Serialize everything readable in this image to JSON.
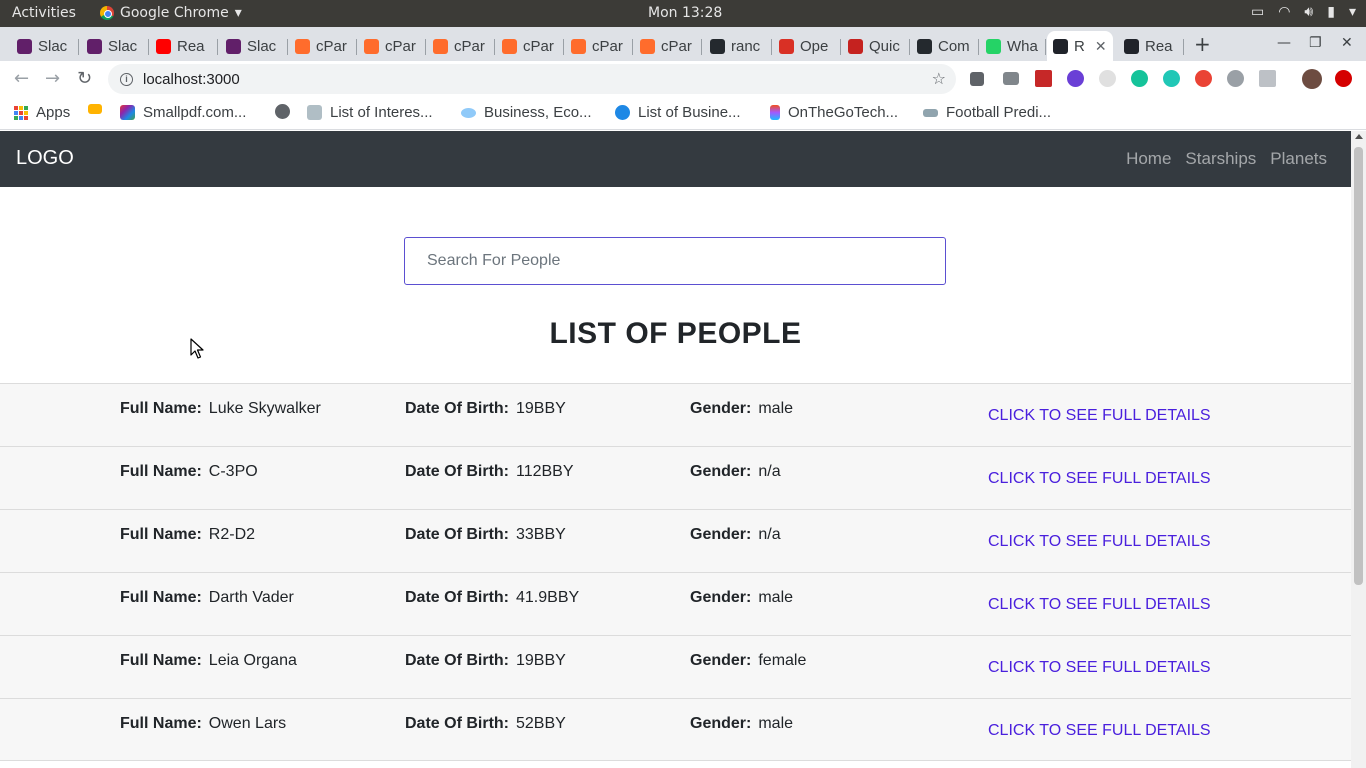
{
  "system_bar": {
    "activities": "Activities",
    "app_name": "Google Chrome",
    "clock": "Mon 13:28"
  },
  "browser": {
    "tabs": [
      {
        "label": "Slac",
        "icon": "slack-icon",
        "color": "#611f69"
      },
      {
        "label": "Slac",
        "icon": "slack-icon",
        "color": "#611f69"
      },
      {
        "label": "Rea",
        "icon": "youtube-icon",
        "color": "#ff0000"
      },
      {
        "label": "Slac",
        "icon": "slack-icon",
        "color": "#611f69"
      },
      {
        "label": "cPar",
        "icon": "cpanel-icon",
        "color": "#ff6c2c"
      },
      {
        "label": "cPar",
        "icon": "cpanel-icon",
        "color": "#ff6c2c"
      },
      {
        "label": "cPar",
        "icon": "cpanel-icon",
        "color": "#ff6c2c"
      },
      {
        "label": "cPar",
        "icon": "cpanel-icon",
        "color": "#ff6c2c"
      },
      {
        "label": "cPar",
        "icon": "cpanel-icon",
        "color": "#ff6c2c"
      },
      {
        "label": "cPar",
        "icon": "cpanel-icon",
        "color": "#ff6c2c"
      },
      {
        "label": "ranc",
        "icon": "github-icon",
        "color": "#24292e"
      },
      {
        "label": "Ope",
        "icon": "gmail-icon",
        "color": "#d93025"
      },
      {
        "label": "Quic",
        "icon": "quick-icon",
        "color": "#c5221f"
      },
      {
        "label": "Com",
        "icon": "github-icon",
        "color": "#24292e"
      },
      {
        "label": "Wha",
        "icon": "whatsapp-icon",
        "color": "#25d366"
      },
      {
        "label": "R",
        "icon": "react-icon",
        "color": "#20232a",
        "active": true
      },
      {
        "label": "Rea",
        "icon": "react-icon",
        "color": "#20232a"
      }
    ],
    "url": "localhost:3000",
    "bookmarks": [
      {
        "label": "Apps"
      },
      {
        "label": "Smallpdf.com..."
      },
      {
        "label": "List of Interes..."
      },
      {
        "label": "Business, Eco..."
      },
      {
        "label": "List of Busine..."
      },
      {
        "label": "OnTheGoTech..."
      },
      {
        "label": "Football Predi..."
      }
    ]
  },
  "app": {
    "logo": "LOGO",
    "nav": [
      "Home",
      "Starships",
      "Planets"
    ],
    "search_placeholder": "Search For People",
    "heading": "LIST OF PEOPLE",
    "labels": {
      "name": "Full Name:",
      "dob": "Date Of Birth:",
      "gender": "Gender:",
      "details": "CLICK TO SEE FULL DETAILS"
    },
    "people": [
      {
        "name": "Luke Skywalker",
        "dob": "19BBY",
        "gender": "male"
      },
      {
        "name": "C-3PO",
        "dob": "112BBY",
        "gender": "n/a"
      },
      {
        "name": "R2-D2",
        "dob": "33BBY",
        "gender": "n/a"
      },
      {
        "name": "Darth Vader",
        "dob": "41.9BBY",
        "gender": "male"
      },
      {
        "name": "Leia Organa",
        "dob": "19BBY",
        "gender": "female"
      },
      {
        "name": "Owen Lars",
        "dob": "52BBY",
        "gender": "male"
      }
    ]
  }
}
